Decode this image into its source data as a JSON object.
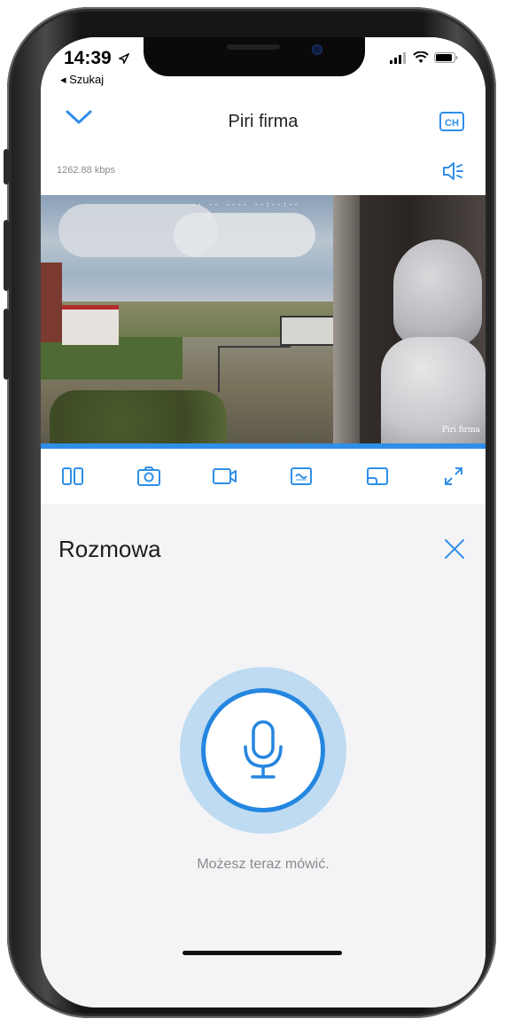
{
  "status_bar": {
    "time": "14:39",
    "back_app": "◂ Szukaj"
  },
  "nav": {
    "title": "Piri firma",
    "channel_label": "CH"
  },
  "stream": {
    "bitrate": "1262.88 kbps",
    "osd_top": "-- -- ---- --:--:--",
    "osd_camera_name": "Piri firma"
  },
  "toolbar": {
    "items": [
      "split-view-icon",
      "snapshot-icon",
      "record-icon",
      "quality-icon",
      "display-mode-icon",
      "fullscreen-icon"
    ]
  },
  "talk_panel": {
    "title": "Rozmowa",
    "hint": "Możesz teraz mówić."
  },
  "colors": {
    "accent": "#2f8fe8",
    "mic_ring": "#2586e0",
    "mic_halo": "#bfdbf1",
    "panel_bg": "#f4f4f6"
  }
}
